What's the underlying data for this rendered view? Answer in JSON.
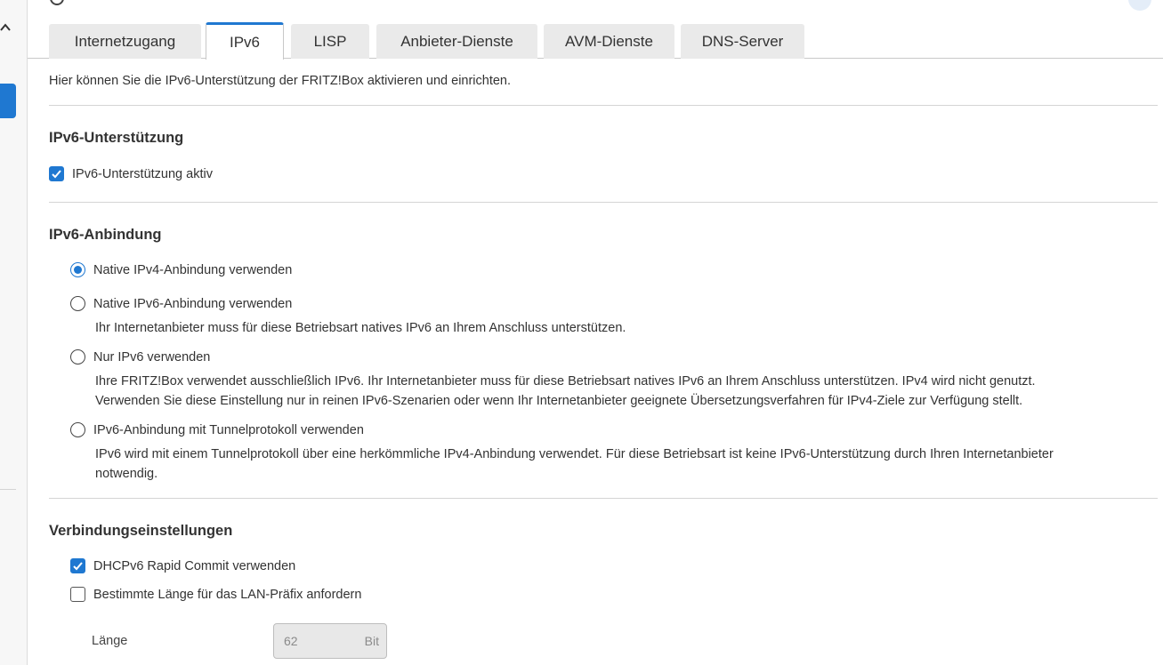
{
  "tabs": [
    {
      "label": "Internetzugang",
      "active": false
    },
    {
      "label": "IPv6",
      "active": true
    },
    {
      "label": "LISP",
      "active": false
    },
    {
      "label": "Anbieter-Dienste",
      "active": false
    },
    {
      "label": "AVM-Dienste",
      "active": false
    },
    {
      "label": "DNS-Server",
      "active": false
    }
  ],
  "intro": "Hier können Sie die IPv6-Unterstützung der FRITZ!Box aktivieren und einrichten.",
  "support": {
    "heading": "IPv6-Unterstützung",
    "checkbox_label": "IPv6-Unterstützung aktiv",
    "checked": true
  },
  "binding": {
    "heading": "IPv6-Anbindung",
    "options": [
      {
        "label": "Native IPv4-Anbindung verwenden",
        "selected": true,
        "desc": ""
      },
      {
        "label": "Native IPv6-Anbindung verwenden",
        "selected": false,
        "desc": "Ihr Internetanbieter muss für diese Betriebsart natives IPv6 an Ihrem Anschluss unterstützen."
      },
      {
        "label": "Nur IPv6 verwenden",
        "selected": false,
        "desc_line1": "Ihre FRITZ!Box verwendet ausschließlich IPv6. Ihr Internetanbieter muss für diese Betriebsart natives IPv6 an Ihrem Anschluss unterstützen. IPv4 wird nicht genutzt.",
        "desc_line2": "Verwenden Sie diese Einstellung nur in reinen IPv6-Szenarien oder wenn Ihr Internetanbieter geeignete Übersetzungsverfahren für IPv4-Ziele zur Verfügung stellt."
      },
      {
        "label": "IPv6-Anbindung mit Tunnelprotokoll verwenden",
        "selected": false,
        "desc_line1": "IPv6 wird mit einem Tunnelprotokoll über eine herkömmliche IPv4-Anbindung verwendet. Für diese Betriebsart ist keine IPv6-Unterstützung durch Ihren Internetanbieter",
        "desc_line2": "notwendig."
      }
    ]
  },
  "connection": {
    "heading": "Verbindungseinstellungen",
    "dhcp_label": "DHCPv6 Rapid Commit verwenden",
    "dhcp_checked": true,
    "prefix_label": "Bestimmte Länge für das LAN-Präfix anfordern",
    "prefix_checked": false,
    "length_label": "Länge",
    "length_value": "62",
    "length_unit": "Bit"
  },
  "colors": {
    "accent": "#1f78d1"
  },
  "icons": {
    "sidebar_toggle": "chevron-up-icon",
    "checkbox": "checkmark-icon"
  }
}
